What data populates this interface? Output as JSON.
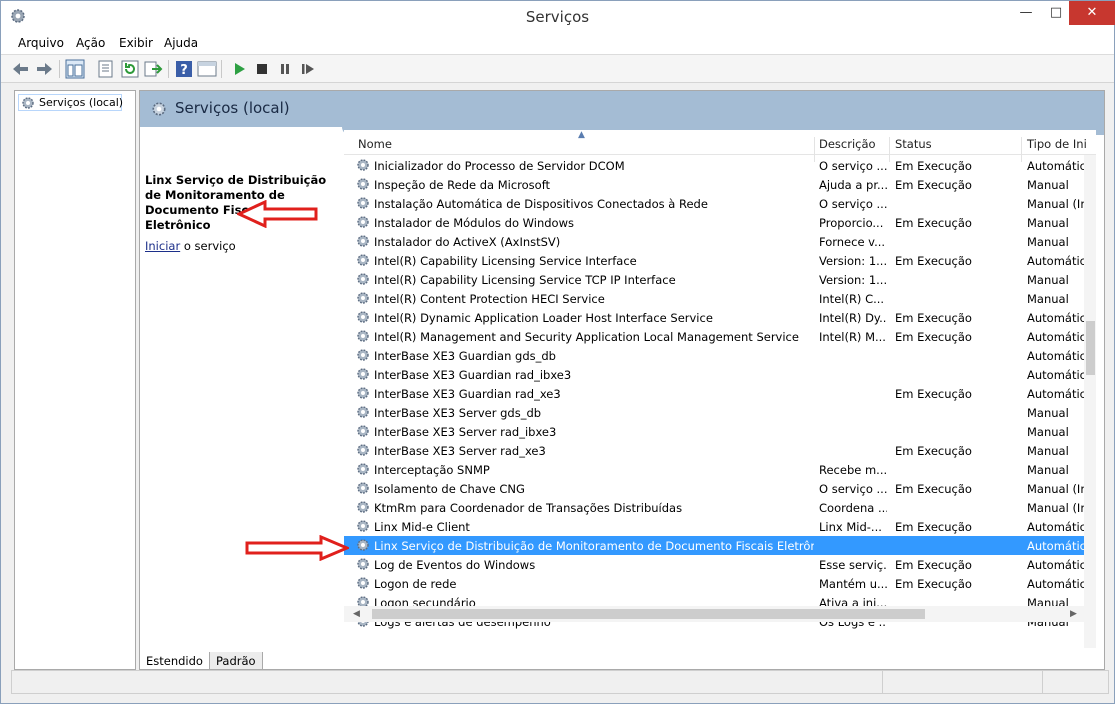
{
  "window": {
    "title": "Serviços",
    "min_label": "—",
    "max_label": "□",
    "close_label": "✕"
  },
  "menu": [
    "Arquivo",
    "Ação",
    "Exibir",
    "Ajuda"
  ],
  "tree": {
    "item": "Serviços (local)"
  },
  "panel": {
    "header": "Serviços (local)",
    "description": "Linx Serviço de Distribuição de Monitoramento de Documento Fiscais Eletrônico",
    "action_link": "Iniciar",
    "action_rest": " o serviço"
  },
  "columns": {
    "name": "Nome",
    "description": "Descrição",
    "status": "Status",
    "startup": "Tipo de Ini"
  },
  "rows": [
    {
      "name": "Inicializador do Processo de Servidor DCOM",
      "desc": "O serviço ...",
      "status": "Em Execução",
      "startup": "Automátic"
    },
    {
      "name": "Inspeção de Rede da Microsoft",
      "desc": "Ajuda a pr...",
      "status": "Em Execução",
      "startup": "Manual"
    },
    {
      "name": "Instalação Automática de Dispositivos Conectados à Rede",
      "desc": "O serviço ...",
      "status": "",
      "startup": "Manual (In"
    },
    {
      "name": "Instalador de Módulos do Windows",
      "desc": "Proporcio...",
      "status": "Em Execução",
      "startup": "Manual"
    },
    {
      "name": "Instalador do ActiveX (AxInstSV)",
      "desc": "Fornece v...",
      "status": "",
      "startup": "Manual"
    },
    {
      "name": "Intel(R) Capability Licensing Service Interface",
      "desc": "Version: 1...",
      "status": "Em Execução",
      "startup": "Automátic"
    },
    {
      "name": "Intel(R) Capability Licensing Service TCP IP Interface",
      "desc": "Version: 1...",
      "status": "",
      "startup": "Manual"
    },
    {
      "name": "Intel(R) Content Protection HECI Service",
      "desc": "Intel(R) C...",
      "status": "",
      "startup": "Manual"
    },
    {
      "name": "Intel(R) Dynamic Application Loader Host Interface Service",
      "desc": "Intel(R) Dy...",
      "status": "Em Execução",
      "startup": "Automátic"
    },
    {
      "name": "Intel(R) Management and Security Application Local Management Service",
      "desc": "Intel(R) M...",
      "status": "Em Execução",
      "startup": "Automátic"
    },
    {
      "name": "InterBase XE3 Guardian gds_db",
      "desc": "",
      "status": "",
      "startup": "Automátic"
    },
    {
      "name": "InterBase XE3 Guardian rad_ibxe3",
      "desc": "",
      "status": "",
      "startup": "Automátic"
    },
    {
      "name": "InterBase XE3 Guardian rad_xe3",
      "desc": "",
      "status": "Em Execução",
      "startup": "Automátic"
    },
    {
      "name": "InterBase XE3 Server gds_db",
      "desc": "",
      "status": "",
      "startup": "Manual"
    },
    {
      "name": "InterBase XE3 Server rad_ibxe3",
      "desc": "",
      "status": "",
      "startup": "Manual"
    },
    {
      "name": "InterBase XE3 Server rad_xe3",
      "desc": "",
      "status": "Em Execução",
      "startup": "Manual"
    },
    {
      "name": "Interceptação SNMP",
      "desc": "Recebe m...",
      "status": "",
      "startup": "Manual"
    },
    {
      "name": "Isolamento de Chave CNG",
      "desc": "O serviço ...",
      "status": "Em Execução",
      "startup": "Manual (In"
    },
    {
      "name": "KtmRm para Coordenador de Transações Distribuídas",
      "desc": "Coordena ...",
      "status": "",
      "startup": "Manual (In"
    },
    {
      "name": "Linx Mid-e Client",
      "desc": "Linx Mid-...",
      "status": "Em Execução",
      "startup": "Automátic"
    },
    {
      "name": "Linx Serviço de Distribuição de Monitoramento de Documento Fiscais Eletrônico",
      "desc": "",
      "status": "",
      "startup": "Automátic",
      "selected": true
    },
    {
      "name": "Log de Eventos do Windows",
      "desc": "Esse serviç...",
      "status": "Em Execução",
      "startup": "Automátic"
    },
    {
      "name": "Logon de rede",
      "desc": "Mantém u...",
      "status": "Em Execução",
      "startup": "Automátic"
    },
    {
      "name": "Logon secundário",
      "desc": "Ativa a ini...",
      "status": "",
      "startup": "Manual"
    },
    {
      "name": "Logs e alertas de desempenho",
      "desc": "Os Logs e ...",
      "status": "",
      "startup": "Manual"
    }
  ],
  "tabs": [
    "Estendido",
    "Padrão"
  ],
  "colors": {
    "selection": "#3399ff",
    "header": "#a4bcd4",
    "close": "#c7372f",
    "arrow": "#e0201c"
  }
}
